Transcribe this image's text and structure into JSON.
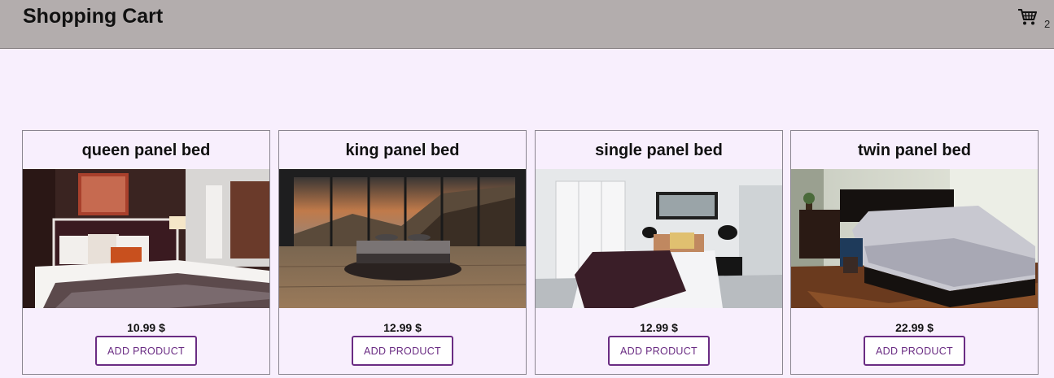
{
  "header": {
    "title": "Shopping Cart",
    "cart_icon": "shopping-cart-icon",
    "cart_count": "2"
  },
  "products": [
    {
      "name": "queen panel bed",
      "price": "10.99 $",
      "button_label": "ADD PRODUCT",
      "image": "bedroom-photo"
    },
    {
      "name": "king panel bed",
      "price": "12.99 $",
      "button_label": "ADD PRODUCT",
      "image": "bedroom-photo"
    },
    {
      "name": "single panel bed",
      "price": "12.99 $",
      "button_label": "ADD PRODUCT",
      "image": "bedroom-photo"
    },
    {
      "name": "twin panel bed",
      "price": "22.99 $",
      "button_label": "ADD PRODUCT",
      "image": "bedroom-photo"
    }
  ],
  "colors": {
    "page_background": "#f8effd",
    "header_background": "#b3adad",
    "button_accent": "#6a2c83"
  }
}
